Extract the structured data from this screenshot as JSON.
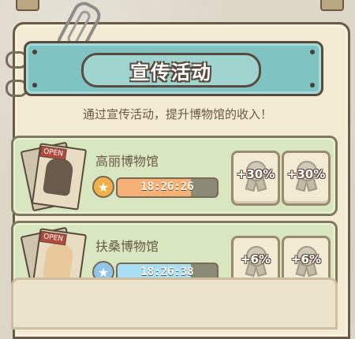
{
  "banner": {
    "title": "宣传活动"
  },
  "subtitle": "通过宣传活动，提升博物馆的收入！",
  "colors": {
    "accent": "#7fc3c2",
    "card": "#d8e7c0",
    "paper": "#f3ebd4"
  },
  "museums": [
    {
      "name": "高丽博物馆",
      "timer": "18:26:26",
      "progress": 0.74,
      "badge_icon": "star-icon",
      "badge_color": "#f2b04a",
      "fill_color": "#f5b176",
      "poster_icon": "poster-woman-icon",
      "bonuses": [
        "+30%",
        "+30%"
      ]
    },
    {
      "name": "扶桑博物馆",
      "timer": "18:26:38",
      "progress": 0.74,
      "badge_icon": "star-icon",
      "badge_color": "#8fc6ea",
      "fill_color": "#a8dff5",
      "poster_icon": "poster-woman-icon",
      "bonuses": [
        "+6%",
        "+6%"
      ]
    }
  ]
}
